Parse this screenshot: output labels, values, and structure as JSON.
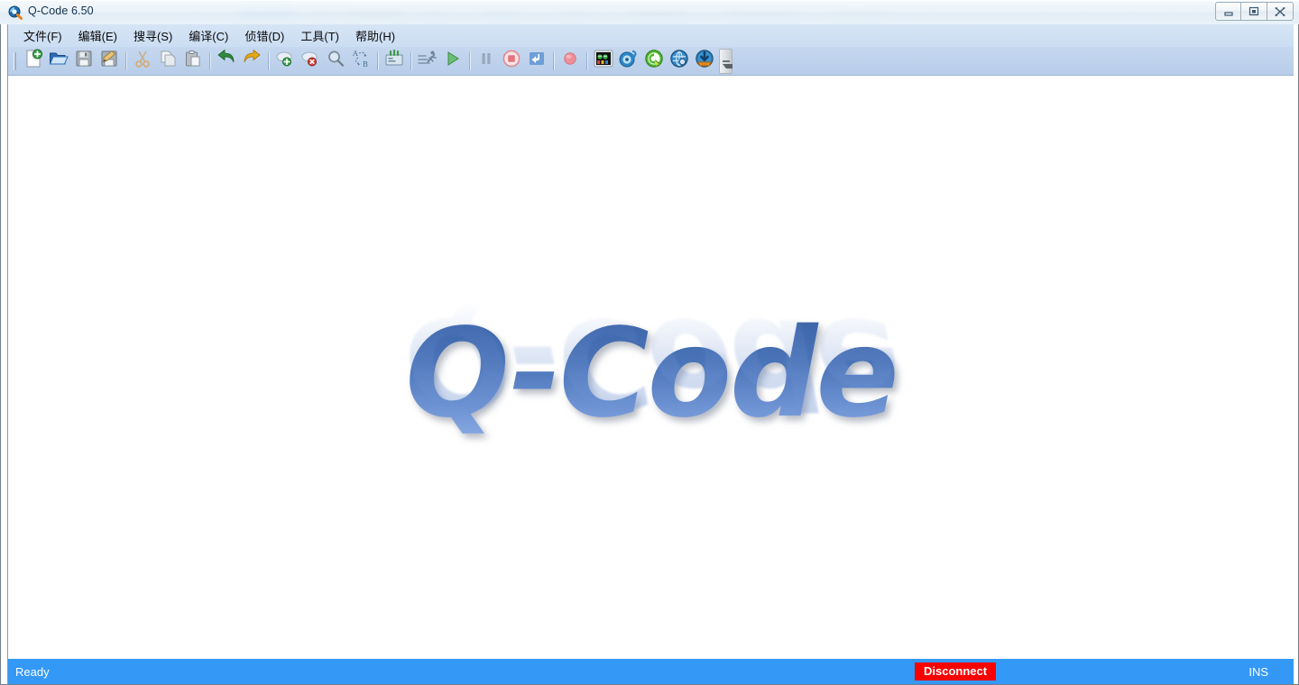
{
  "window": {
    "title": "Q-Code 6.50",
    "app_icon": "qcode-magnifier-icon",
    "controls": {
      "minimize": "minimize-button",
      "maximize": "maximize-button",
      "close": "close-button"
    }
  },
  "menubar": {
    "items": [
      {
        "label": "文件(F)",
        "name": "menu-file"
      },
      {
        "label": "编辑(E)",
        "name": "menu-edit"
      },
      {
        "label": "搜寻(S)",
        "name": "menu-search"
      },
      {
        "label": "编译(C)",
        "name": "menu-compile"
      },
      {
        "label": "侦错(D)",
        "name": "menu-debug"
      },
      {
        "label": "工具(T)",
        "name": "menu-tools"
      },
      {
        "label": "帮助(H)",
        "name": "menu-help"
      }
    ]
  },
  "toolbar": {
    "overflow_label": "toolbar-overflow",
    "groups": [
      [
        "new-file-icon",
        "open-file-icon",
        "save-file-icon",
        "save-as-icon"
      ],
      [
        "cut-icon",
        "copy-icon",
        "paste-icon"
      ],
      [
        "undo-icon",
        "redo-icon"
      ],
      [
        "add-bookmark-icon",
        "remove-bookmark-icon",
        "find-icon",
        "goto-line-icon"
      ],
      [
        "compile-icon"
      ],
      [
        "build-and-run-icon",
        "run-icon"
      ],
      [
        "pause-icon",
        "stop-icon",
        "step-out-icon"
      ],
      [
        "breakpoint-icon"
      ],
      [
        "simulator-icon",
        "oscilloscope-icon",
        "qcode-tool-icon",
        "network-tool-icon",
        "download-icon"
      ]
    ]
  },
  "workspace": {
    "logo_text": "Q-Code"
  },
  "statusbar": {
    "ready": "Ready",
    "connection": "Disconnect",
    "insert_mode": "INS"
  },
  "colors": {
    "status_bar_blue": "#3498f6",
    "disconnect_red": "#fa0000",
    "toolbar_blue": "#bed2ec",
    "menubar_blue": "#d2e1f4",
    "logo_blue": "#4a74b8"
  }
}
